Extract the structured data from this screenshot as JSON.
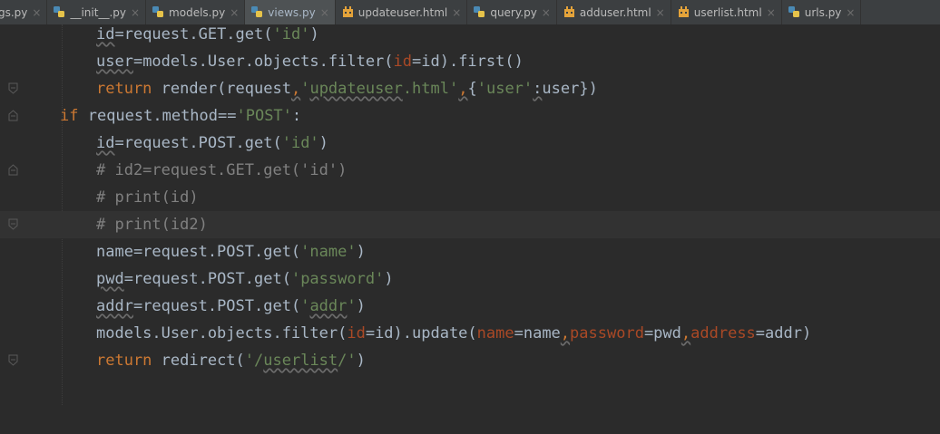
{
  "tabs": [
    {
      "label": "gs.py",
      "icon": "python-file-icon",
      "active": false
    },
    {
      "label": "__init__.py",
      "icon": "python-file-icon",
      "active": false
    },
    {
      "label": "models.py",
      "icon": "python-file-icon",
      "active": false
    },
    {
      "label": "views.py",
      "icon": "python-file-icon",
      "active": true
    },
    {
      "label": "updateuser.html",
      "icon": "html-file-icon",
      "active": false
    },
    {
      "label": "query.py",
      "icon": "python-file-icon",
      "active": false
    },
    {
      "label": "adduser.html",
      "icon": "html-file-icon",
      "active": false
    },
    {
      "label": "userlist.html",
      "icon": "html-file-icon",
      "active": false
    },
    {
      "label": "urls.py",
      "icon": "python-file-icon",
      "active": false
    }
  ],
  "tab_close_glyph": "×",
  "code": {
    "l1": {
      "a": "id",
      "b": "=request.GET.get(",
      "c": "'id'",
      "d": ")"
    },
    "l2": {
      "a": "user",
      "b": "=models.User.objects.filter(",
      "c": "id",
      "d": "=id).first()"
    },
    "l3": {
      "a": "return",
      "b": " render(request",
      "c": ",",
      "d": "'",
      "e": "updateuser",
      "f": ".html'",
      "g": ",",
      "h": "{",
      "i": "'user'",
      "j": ":",
      "k": "user})"
    },
    "l4": {
      "a": "if",
      "b": " request.method==",
      "c": "'POST'",
      "d": ":"
    },
    "l5": {
      "a": "id",
      "b": "=request.POST.get(",
      "c": "'id'",
      "d": ")"
    },
    "l6": {
      "a": "# id2=request.GET.get('id')"
    },
    "l7": {
      "a": "# print(id)"
    },
    "l8": {
      "a": "# print(id2)"
    },
    "l9": {
      "a": "name=request.POST.get(",
      "b": "'name'",
      "c": ")"
    },
    "l10": {
      "a": "pwd",
      "b": "=request.POST.get(",
      "c": "'password'",
      "d": ")"
    },
    "l11": {
      "a": "addr",
      "b": "=request.POST.get(",
      "c": "'",
      "d": "addr",
      "e": "'",
      "f": ")"
    },
    "l12": {
      "a": "models.User.objects.filter(",
      "b": "id",
      "c": "=id).update(",
      "d": "name",
      "e": "=name",
      "f": ",",
      "g": "password",
      "h": "=pwd",
      "i": ",",
      "j": "address",
      "k": "=addr)"
    },
    "l13": {
      "a": "return",
      "b": " redirect(",
      "c": "'/",
      "d": "userlist",
      "e": "/'",
      "f": ")"
    }
  },
  "colors": {
    "keyword": "#cc7832",
    "string": "#6a8759",
    "comment": "#808080",
    "parameter": "#aa4926",
    "text": "#a9b7c6",
    "background": "#2b2b2b"
  }
}
